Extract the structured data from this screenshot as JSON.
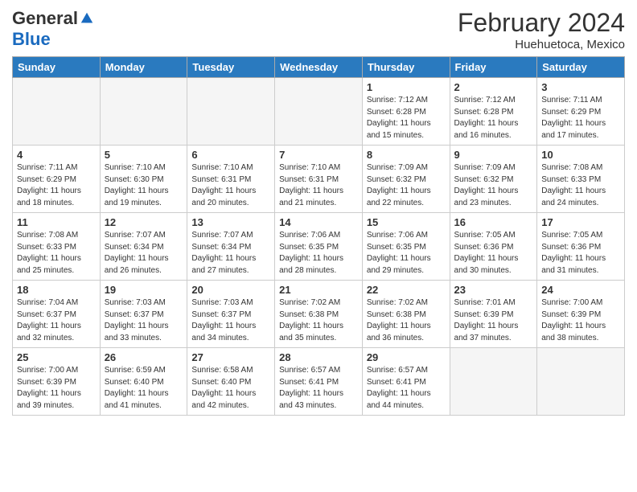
{
  "header": {
    "logo": {
      "general": "General",
      "blue": "Blue"
    },
    "title": "February 2024",
    "location": "Huehuetoca, Mexico"
  },
  "days_of_week": [
    "Sunday",
    "Monday",
    "Tuesday",
    "Wednesday",
    "Thursday",
    "Friday",
    "Saturday"
  ],
  "weeks": [
    [
      {
        "num": "",
        "info": ""
      },
      {
        "num": "",
        "info": ""
      },
      {
        "num": "",
        "info": ""
      },
      {
        "num": "",
        "info": ""
      },
      {
        "num": "1",
        "info": "Sunrise: 7:12 AM\nSunset: 6:28 PM\nDaylight: 11 hours and 15 minutes."
      },
      {
        "num": "2",
        "info": "Sunrise: 7:12 AM\nSunset: 6:28 PM\nDaylight: 11 hours and 16 minutes."
      },
      {
        "num": "3",
        "info": "Sunrise: 7:11 AM\nSunset: 6:29 PM\nDaylight: 11 hours and 17 minutes."
      }
    ],
    [
      {
        "num": "4",
        "info": "Sunrise: 7:11 AM\nSunset: 6:29 PM\nDaylight: 11 hours and 18 minutes."
      },
      {
        "num": "5",
        "info": "Sunrise: 7:10 AM\nSunset: 6:30 PM\nDaylight: 11 hours and 19 minutes."
      },
      {
        "num": "6",
        "info": "Sunrise: 7:10 AM\nSunset: 6:31 PM\nDaylight: 11 hours and 20 minutes."
      },
      {
        "num": "7",
        "info": "Sunrise: 7:10 AM\nSunset: 6:31 PM\nDaylight: 11 hours and 21 minutes."
      },
      {
        "num": "8",
        "info": "Sunrise: 7:09 AM\nSunset: 6:32 PM\nDaylight: 11 hours and 22 minutes."
      },
      {
        "num": "9",
        "info": "Sunrise: 7:09 AM\nSunset: 6:32 PM\nDaylight: 11 hours and 23 minutes."
      },
      {
        "num": "10",
        "info": "Sunrise: 7:08 AM\nSunset: 6:33 PM\nDaylight: 11 hours and 24 minutes."
      }
    ],
    [
      {
        "num": "11",
        "info": "Sunrise: 7:08 AM\nSunset: 6:33 PM\nDaylight: 11 hours and 25 minutes."
      },
      {
        "num": "12",
        "info": "Sunrise: 7:07 AM\nSunset: 6:34 PM\nDaylight: 11 hours and 26 minutes."
      },
      {
        "num": "13",
        "info": "Sunrise: 7:07 AM\nSunset: 6:34 PM\nDaylight: 11 hours and 27 minutes."
      },
      {
        "num": "14",
        "info": "Sunrise: 7:06 AM\nSunset: 6:35 PM\nDaylight: 11 hours and 28 minutes."
      },
      {
        "num": "15",
        "info": "Sunrise: 7:06 AM\nSunset: 6:35 PM\nDaylight: 11 hours and 29 minutes."
      },
      {
        "num": "16",
        "info": "Sunrise: 7:05 AM\nSunset: 6:36 PM\nDaylight: 11 hours and 30 minutes."
      },
      {
        "num": "17",
        "info": "Sunrise: 7:05 AM\nSunset: 6:36 PM\nDaylight: 11 hours and 31 minutes."
      }
    ],
    [
      {
        "num": "18",
        "info": "Sunrise: 7:04 AM\nSunset: 6:37 PM\nDaylight: 11 hours and 32 minutes."
      },
      {
        "num": "19",
        "info": "Sunrise: 7:03 AM\nSunset: 6:37 PM\nDaylight: 11 hours and 33 minutes."
      },
      {
        "num": "20",
        "info": "Sunrise: 7:03 AM\nSunset: 6:37 PM\nDaylight: 11 hours and 34 minutes."
      },
      {
        "num": "21",
        "info": "Sunrise: 7:02 AM\nSunset: 6:38 PM\nDaylight: 11 hours and 35 minutes."
      },
      {
        "num": "22",
        "info": "Sunrise: 7:02 AM\nSunset: 6:38 PM\nDaylight: 11 hours and 36 minutes."
      },
      {
        "num": "23",
        "info": "Sunrise: 7:01 AM\nSunset: 6:39 PM\nDaylight: 11 hours and 37 minutes."
      },
      {
        "num": "24",
        "info": "Sunrise: 7:00 AM\nSunset: 6:39 PM\nDaylight: 11 hours and 38 minutes."
      }
    ],
    [
      {
        "num": "25",
        "info": "Sunrise: 7:00 AM\nSunset: 6:39 PM\nDaylight: 11 hours and 39 minutes."
      },
      {
        "num": "26",
        "info": "Sunrise: 6:59 AM\nSunset: 6:40 PM\nDaylight: 11 hours and 41 minutes."
      },
      {
        "num": "27",
        "info": "Sunrise: 6:58 AM\nSunset: 6:40 PM\nDaylight: 11 hours and 42 minutes."
      },
      {
        "num": "28",
        "info": "Sunrise: 6:57 AM\nSunset: 6:41 PM\nDaylight: 11 hours and 43 minutes."
      },
      {
        "num": "29",
        "info": "Sunrise: 6:57 AM\nSunset: 6:41 PM\nDaylight: 11 hours and 44 minutes."
      },
      {
        "num": "",
        "info": ""
      },
      {
        "num": "",
        "info": ""
      }
    ]
  ]
}
